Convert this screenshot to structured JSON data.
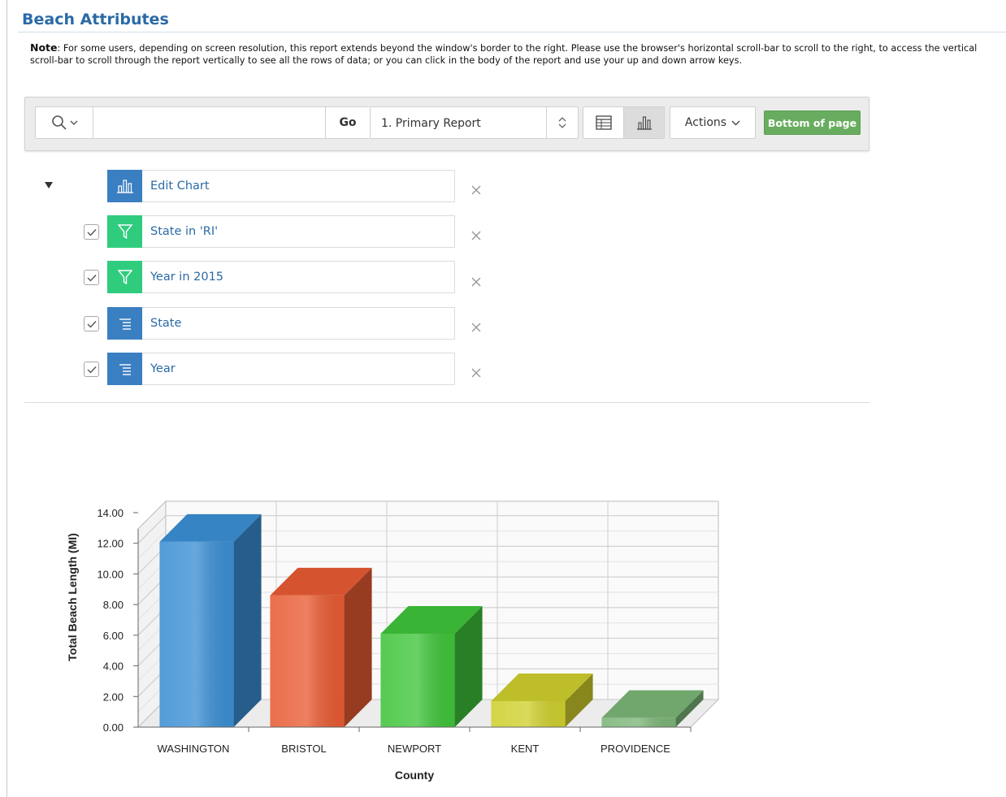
{
  "page": {
    "title": "Beach Attributes",
    "note_label": "Note",
    "note_text": ": For some users, depending on screen resolution, this report extends beyond the window's border to the right. Please use the browser's horizontal scroll-bar to scroll to the right, to access the vertical scroll-bar to scroll through the report vertically to see all the rows of data; or you can click in the body of the report and use your up and down arrow keys."
  },
  "toolbar": {
    "search_value": "",
    "search_placeholder": "",
    "go_label": "Go",
    "report_selected": "1. Primary Report",
    "actions_label": "Actions",
    "bottom_label": "Bottom of page"
  },
  "settings": {
    "chart": "Edit Chart",
    "filter_state": "State in 'RI'",
    "filter_year": "Year in 2015",
    "control_break_state": "State",
    "control_break_year": "Year"
  },
  "colors": {
    "accent": "#2a6aa6",
    "filter_badge": "#2fcc7e",
    "control_badge": "#3a7fc1",
    "bottom_button": "#68ad5f"
  },
  "chart_data": {
    "type": "bar",
    "three_d": true,
    "categories": [
      "WASHINGTON",
      "BRISTOL",
      "NEWPORT",
      "KENT",
      "PROVIDENCE"
    ],
    "values": [
      12.1,
      8.6,
      6.1,
      1.7,
      0.6
    ],
    "colors": [
      "#3b8fd4",
      "#e85b33",
      "#3fc43a",
      "#cfcf2e",
      "#7bb577"
    ],
    "xlabel": "County",
    "ylabel": "Total Beach Length (MI)",
    "ylim": [
      0,
      14
    ],
    "yticks": [
      "0.00",
      "2.00",
      "4.00",
      "6.00",
      "8.00",
      "10.00",
      "12.00",
      "14.00"
    ],
    "grid": true
  }
}
